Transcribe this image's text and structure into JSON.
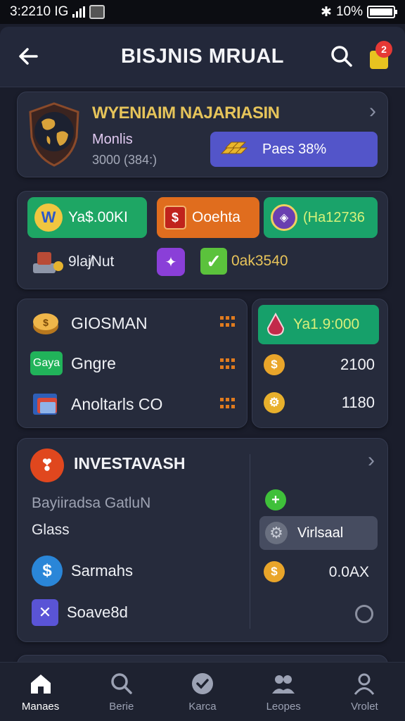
{
  "status_bar": {
    "time": "3:2210 IG",
    "battery": "10%"
  },
  "header": {
    "title": "BISJNIS MRUAL",
    "cart_badge": "2"
  },
  "profile_card": {
    "title": "WYENIAIM NAJARIASIN",
    "label": "Monlis",
    "value": "3000 (384:)",
    "pass_button": "Paes 38%"
  },
  "wallets_card": {
    "pills": [
      {
        "label": "Ya$.00KI"
      },
      {
        "label": "Ooehta"
      },
      {
        "label": "(Ha12736"
      }
    ],
    "row2": {
      "item1": "9laj̸Nut",
      "item3": "0ak3540"
    }
  },
  "list_card": {
    "rows": [
      {
        "label": "GIOSMAN"
      },
      {
        "label": "Gngre",
        "tag": "Gaya"
      },
      {
        "label": "Anoltarls CO"
      }
    ]
  },
  "values_card": {
    "pill": "Ya1.9:000",
    "rows": [
      {
        "value": "2100"
      },
      {
        "value": "1180"
      }
    ]
  },
  "invest_card": {
    "title": "INVESTAVASH",
    "subtitle": "Bayiiradsa GatluN",
    "plain": "Glass",
    "rows": [
      {
        "label": "Sarmahs"
      },
      {
        "label": "Soave8d"
      }
    ],
    "virtual_button": "Virlsaal",
    "amount": "0.0AX"
  },
  "bottom_nav": {
    "items": [
      {
        "label": "Manaes"
      },
      {
        "label": "Berie"
      },
      {
        "label": "Karca"
      },
      {
        "label": "Leopes"
      },
      {
        "label": "Vrolet"
      }
    ]
  },
  "colors": {
    "accent_purple": "#5355c9",
    "accent_green": "#1ea664",
    "accent_orange": "#e06d1e",
    "gold": "#e6c45a",
    "badge_red": "#e53935"
  }
}
